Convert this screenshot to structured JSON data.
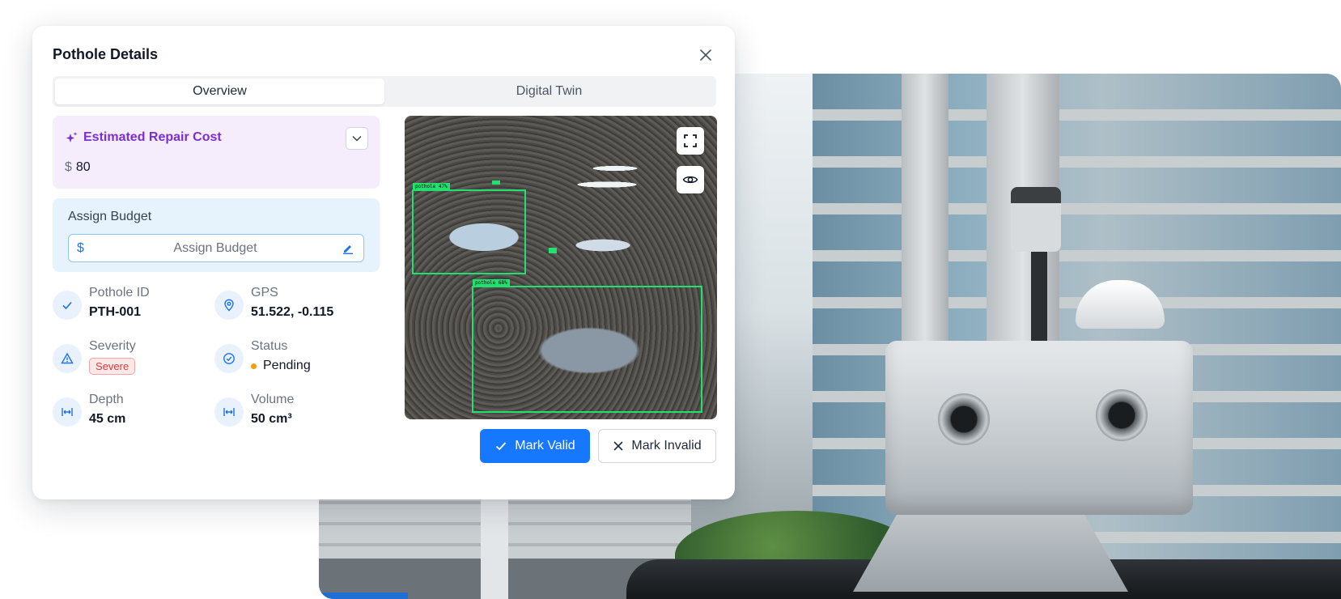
{
  "modal": {
    "title": "Pothole Details",
    "close_icon": "close-icon"
  },
  "tabs": [
    {
      "label": "Overview",
      "active": true
    },
    {
      "label": "Digital Twin",
      "active": false
    }
  ],
  "repair_cost": {
    "title": "Estimated Repair Cost",
    "icon": "sparkle-icon",
    "currency_symbol": "$",
    "value": "80",
    "accent_color": "#7b2fd0"
  },
  "budget": {
    "label": "Assign Budget",
    "currency_symbol": "$",
    "placeholder": "Assign Budget",
    "value": ""
  },
  "details": {
    "pothole_id": {
      "label": "Pothole ID",
      "value": "PTH-001",
      "icon": "check-icon"
    },
    "gps": {
      "label": "GPS",
      "value": "51.522, -0.115",
      "icon": "location-pin-icon"
    },
    "severity": {
      "label": "Severity",
      "value": "Severe",
      "icon": "warning-icon",
      "color": "#e0373b"
    },
    "status": {
      "label": "Status",
      "value": "Pending",
      "icon": "check-circle-icon",
      "color": "#f59e0b"
    },
    "depth": {
      "label": "Depth",
      "value": "45 cm",
      "icon": "measure-icon"
    },
    "volume": {
      "label": "Volume",
      "value": "50 cm³",
      "icon": "measure-icon"
    }
  },
  "photo": {
    "detections": [
      {
        "label": "pothole  47%"
      },
      {
        "label": "pothole  68%"
      }
    ],
    "fullscreen_icon": "fullscreen-icon",
    "visibility_icon": "eye-icon"
  },
  "actions": {
    "valid_label": "Mark Valid",
    "invalid_label": "Mark Invalid",
    "primary_color": "#1677ff"
  }
}
